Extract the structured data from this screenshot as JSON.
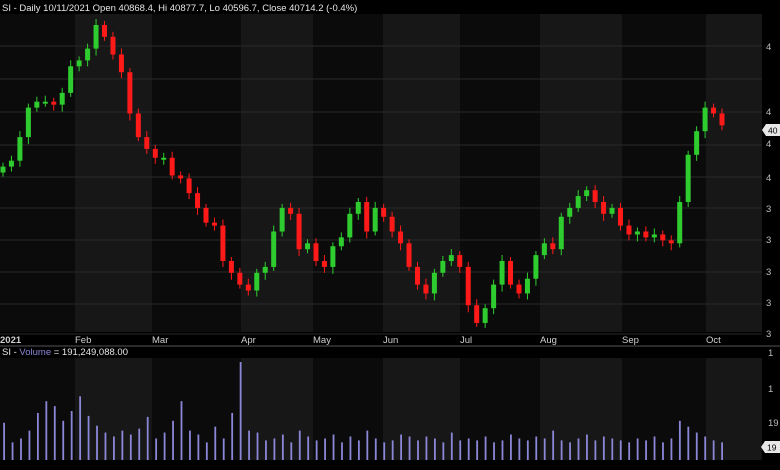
{
  "header": {
    "price_title": "SI - Daily 10/11/2021 Open 40868.4, Hi 40877.7, Lo 40596.7, Close 40714.2 (-0.4%)",
    "volume_prefix": "SI - ",
    "volume_label": "Volume",
    "volume_value": " = 191,249,088.00"
  },
  "colors": {
    "background": "#000000",
    "band_dark": "#0b0b0b",
    "band_light": "#171717",
    "up": "#2ecc2e",
    "down": "#ff1a1a",
    "volume": "#8c87d8",
    "grid": "#2a2a2a",
    "badge_bg": "#e8e8e8"
  },
  "axis": {
    "months": [
      "2021",
      "Feb",
      "Mar",
      "Apr",
      "May",
      "Jun",
      "Jul",
      "Aug",
      "Sep",
      "Oct"
    ],
    "price_tick_labels": [
      "4",
      "4",
      "4",
      "4",
      "3",
      "3",
      "3",
      "3",
      "3"
    ],
    "price_badge": "40",
    "volume_tick_labels": [
      "1",
      "1",
      "19"
    ],
    "volume_badge": "19"
  },
  "chart_data": {
    "type": "candlestick",
    "note": "values read relative to the visible price grid (0 = bottom gridline, 100 = top of chart area)",
    "last_bar": {
      "open": 40868.4,
      "high": 40877.7,
      "low": 40596.7,
      "close": 40714.2
    },
    "price_series": [
      52,
      54,
      62,
      72,
      74,
      74,
      73,
      77,
      86,
      88,
      92,
      100,
      96,
      90,
      84,
      70,
      62,
      58,
      55,
      55,
      49,
      48,
      43,
      38,
      33,
      32,
      20,
      16,
      12,
      10,
      16,
      18,
      30,
      38,
      36,
      24,
      26,
      20,
      18,
      25,
      28,
      36,
      40,
      30,
      38,
      35,
      30,
      26,
      18,
      12,
      9,
      16,
      20,
      22,
      18,
      5,
      -1,
      4,
      12,
      20,
      12,
      9,
      14,
      22,
      26,
      24,
      35,
      38,
      42,
      44,
      40,
      36,
      38,
      32,
      29,
      30,
      28,
      29,
      27,
      26,
      40,
      56,
      64,
      72,
      70,
      66
    ],
    "volume_series": [
      38,
      18,
      22,
      30,
      48,
      60,
      55,
      40,
      50,
      65,
      45,
      35,
      28,
      24,
      30,
      26,
      32,
      44,
      22,
      28,
      40,
      60,
      30,
      26,
      18,
      34,
      22,
      48,
      100,
      30,
      28,
      20,
      22,
      26,
      18,
      30,
      24,
      20,
      22,
      26,
      18,
      24,
      20,
      30,
      22,
      18,
      20,
      26,
      24,
      20,
      24,
      22,
      18,
      28,
      20,
      22,
      20,
      24,
      18,
      20,
      26,
      22,
      20,
      24,
      22,
      30,
      20,
      18,
      22,
      26,
      20,
      24,
      22,
      20,
      18,
      22,
      20,
      24,
      18,
      22,
      40,
      34,
      28,
      24,
      20,
      18
    ]
  }
}
